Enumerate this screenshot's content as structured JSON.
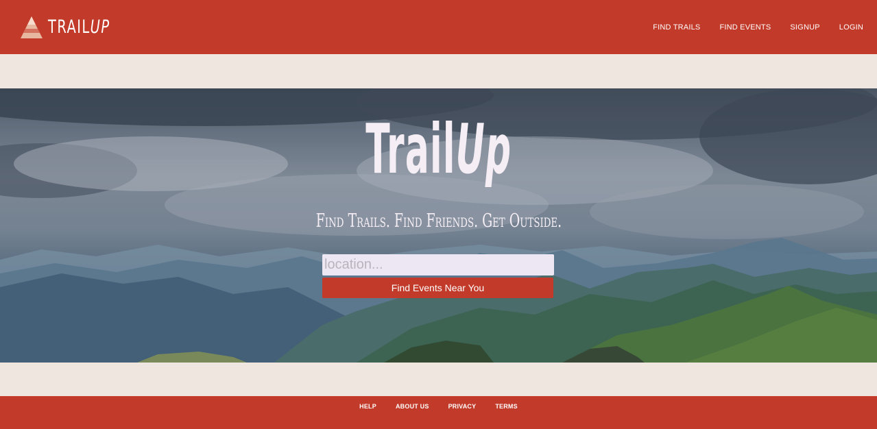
{
  "header": {
    "brand_main": "TRAIL",
    "brand_accent": "UP",
    "nav": [
      "FIND TRAILS",
      "FIND EVENTS",
      "SIGNUP",
      "LOGIN"
    ]
  },
  "hero": {
    "title_main": "Trail",
    "title_accent": "Up",
    "tagline": "Find Trails. Find Friends. Get Outside.",
    "search_placeholder": "location...",
    "button_label": "Find Events Near You"
  },
  "footer": {
    "links": [
      "HELP",
      "ABOUT US",
      "PRIVACY",
      "TERMS"
    ]
  },
  "colors": {
    "brand_red": "#c23a29",
    "page_bg": "#efe6e0",
    "light_text": "#f5eef4"
  },
  "icons": {
    "logo": "mountain-triangle-icon"
  }
}
